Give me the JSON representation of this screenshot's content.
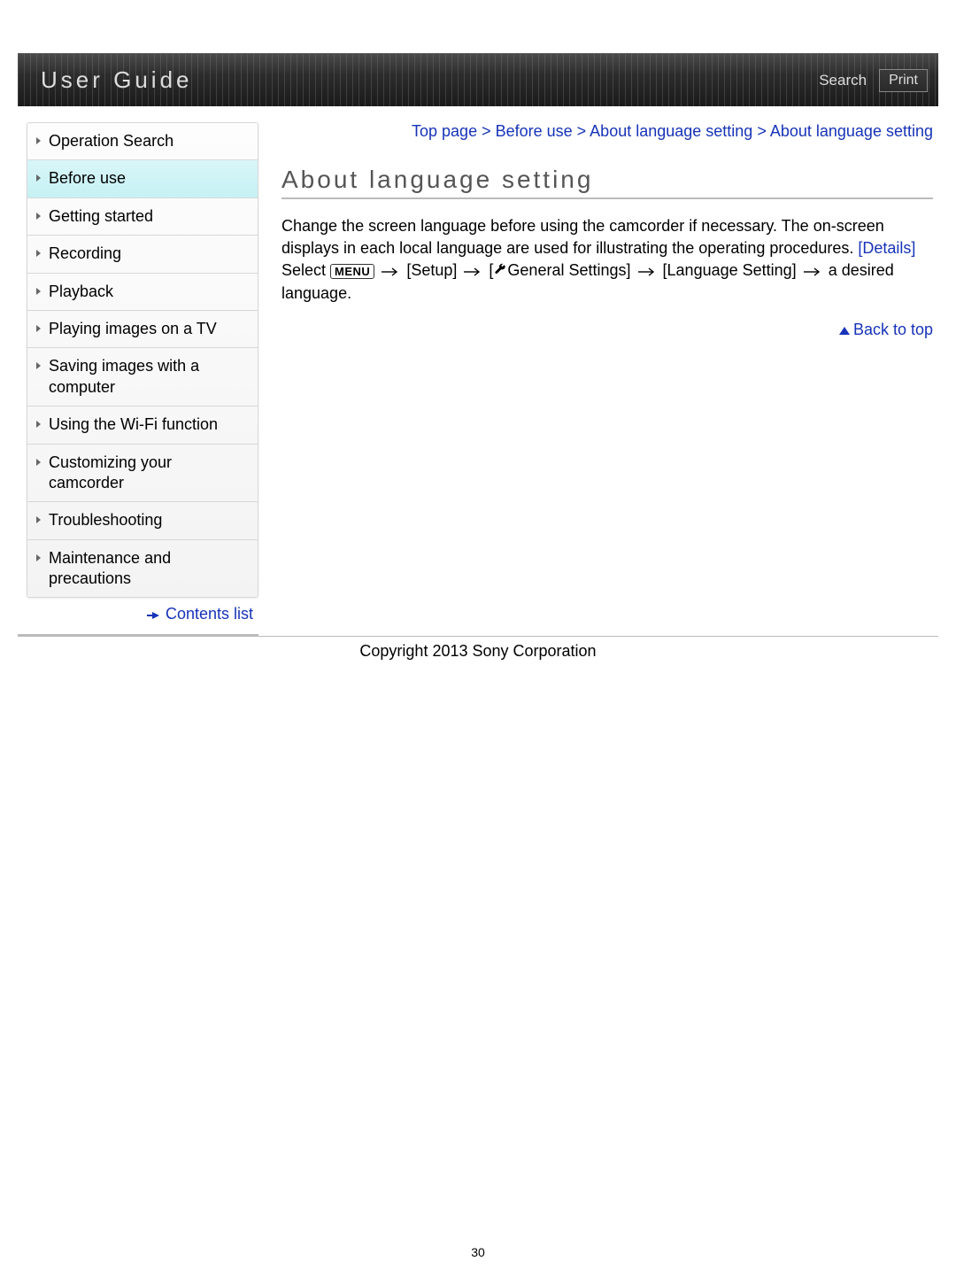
{
  "header": {
    "title": "User Guide",
    "search": "Search",
    "print": "Print"
  },
  "breadcrumb": {
    "items": [
      "Top page",
      "Before use",
      "About language setting",
      "About language setting"
    ],
    "sep": " > "
  },
  "sidebar": {
    "items": [
      {
        "label": "Operation Search",
        "active": false
      },
      {
        "label": "Before use",
        "active": true
      },
      {
        "label": "Getting started",
        "active": false
      },
      {
        "label": "Recording",
        "active": false
      },
      {
        "label": "Playback",
        "active": false
      },
      {
        "label": "Playing images on a TV",
        "active": false
      },
      {
        "label": "Saving images with a computer",
        "active": false
      },
      {
        "label": "Using the Wi-Fi function",
        "active": false
      },
      {
        "label": "Customizing your camcorder",
        "active": false
      },
      {
        "label": "Troubleshooting",
        "active": false
      },
      {
        "label": "Maintenance and precautions",
        "active": false
      }
    ],
    "contents_list": "Contents list"
  },
  "page": {
    "title": "About language setting",
    "para1": "Change the screen language before using the camcorder if necessary. The on-screen displays in each local language are used for illustrating the operating procedures. ",
    "details": "[Details]",
    "select_word": "Select ",
    "menu_chip": "MENU",
    "setup": " [Setup] ",
    "general_prefix": " [",
    "general": "General Settings] ",
    "lang_setting": " [Language Setting] ",
    "tail": " a desired language.",
    "back_to_top": "Back to top"
  },
  "footer": {
    "copyright": "Copyright 2013 Sony Corporation",
    "page_number": "30"
  }
}
